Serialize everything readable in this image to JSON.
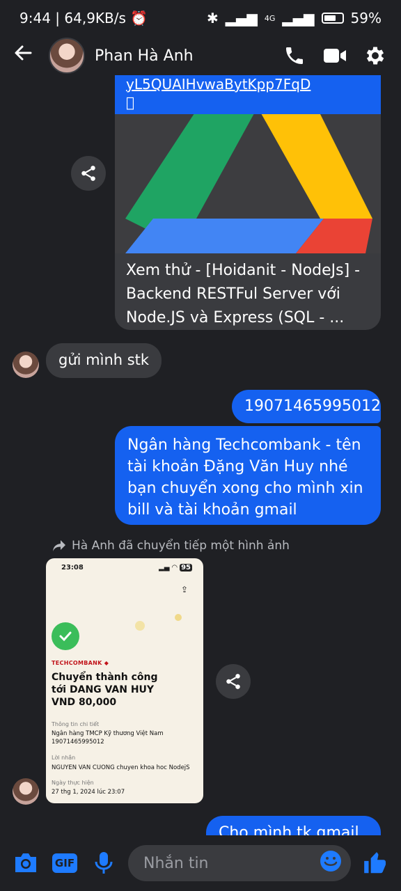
{
  "status": {
    "time": "9:44",
    "speed": "64,9KB/s",
    "net": "4G",
    "battery": "59%"
  },
  "header": {
    "name": "Phan Hà Anh"
  },
  "link_card": {
    "url_text": "yL5QUAIHvwaBytKpp7FqD",
    "url_text2": "\u0000",
    "title": "Xem thử - [Hoidanit - NodeJs] - Backend RESTFul Server với Node.JS và Express (SQL - ..."
  },
  "messages": {
    "in1": "gửi mình stk",
    "out1": "19071465995012",
    "out2": "Ngân hàng Techcombank - tên tài khoản Đặng Văn Huy nhé bạn chuyển xong cho mình xin bill và tài khoản gmail",
    "forward_note": "Hà Anh đã chuyển tiếp một hình ảnh",
    "out3": "Cho mình tk gmail b"
  },
  "receipt": {
    "time": "23:08",
    "battery": "95",
    "brand": "TECHCOMBANK",
    "title1": "Chuyển thành công",
    "title2": "tới DANG VAN HUY",
    "amount": "VND 80,000",
    "details_label": "Thông tin chi tiết",
    "bank": "Ngân hàng TMCP Kỹ thương Việt Nam",
    "account": "19071465995012",
    "note_label": "Lời nhắn",
    "note": "NGUYEN VAN CUONG chuyen khoa hoc NodejS",
    "date_label": "Ngày thực hiện",
    "date": "27 thg 1, 2024 lúc 23:07"
  },
  "composer": {
    "placeholder": "Nhắn tin"
  },
  "colors": {
    "accent": "#1561f0",
    "bubble_in": "#3a3b3f",
    "background": "#1f2024"
  }
}
